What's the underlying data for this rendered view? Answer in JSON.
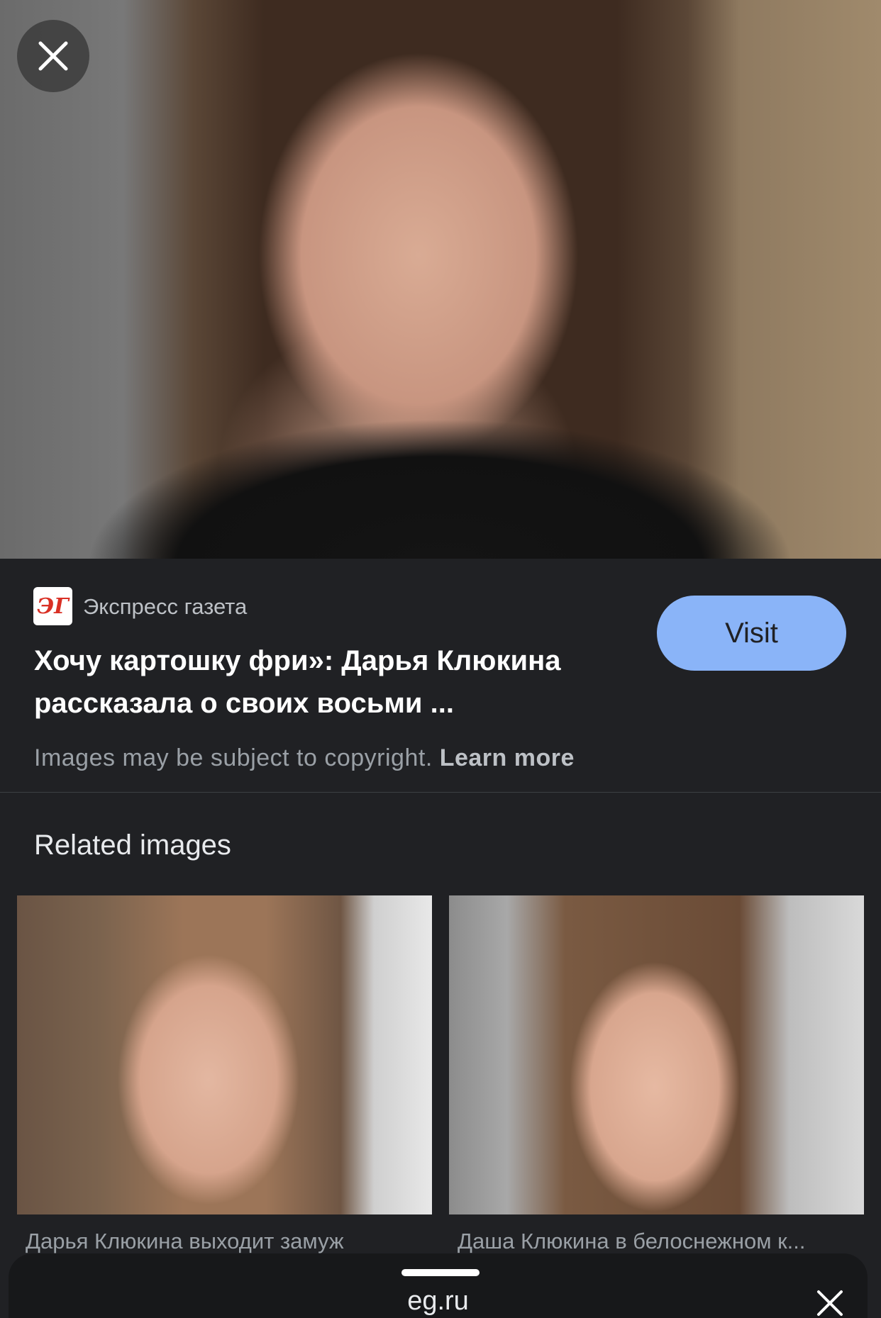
{
  "viewer": {
    "close_icon": "close-icon",
    "hero_alt": "Portrait photo"
  },
  "source": {
    "logo_text": "ЭГ",
    "name": "Экспресс газета",
    "title": "Хочу картошку фри»: Дарья Клюкина рассказала о своих восьми ...",
    "visit_label": "Visit",
    "copyright_text": "Images may be subject to copyright.",
    "learn_more_label": "Learn more"
  },
  "related": {
    "heading": "Related images",
    "items": [
      {
        "caption": "Дарья Клюкина выходит замуж"
      },
      {
        "caption": "Даша Клюкина в белоснежном к..."
      }
    ]
  },
  "sheet": {
    "domain": "eg.ru",
    "close_icon": "close-icon"
  },
  "colors": {
    "background": "#202124",
    "visit_button": "#8ab4f8",
    "sheet": "#17181a"
  }
}
